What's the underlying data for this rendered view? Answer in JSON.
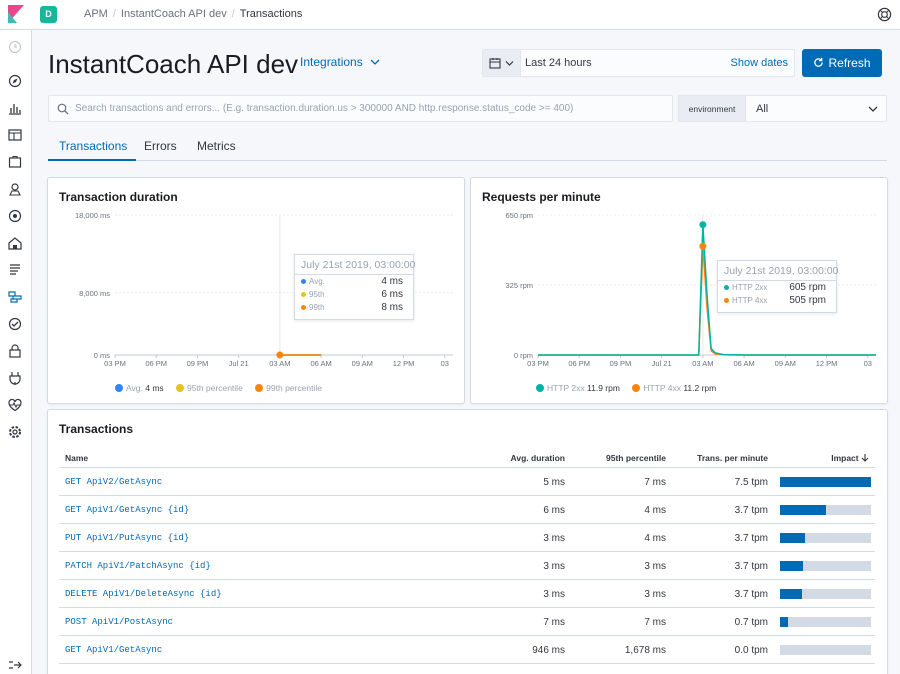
{
  "topbar": {
    "space_letter": "D",
    "breadcrumbs": [
      "APM",
      "InstantCoach API dev",
      "Transactions"
    ]
  },
  "header": {
    "title": "InstantCoach API dev",
    "integrations_label": "Integrations"
  },
  "datepicker": {
    "range": "Last 24 hours",
    "show_dates": "Show dates",
    "refresh_label": "Refresh"
  },
  "search": {
    "placeholder": "Search transactions and errors... (E.g. transaction.duration.us > 300000 AND http.response.status_code >= 400)"
  },
  "environment": {
    "label": "environment",
    "value": "All"
  },
  "tabs": [
    "Transactions",
    "Errors",
    "Metrics"
  ],
  "colors": {
    "accent": "#006bb4",
    "avg": "#3185fc",
    "p95": "#e6c220",
    "p99": "#f98510",
    "http2xx": "#00b3a4",
    "http4xx": "#f98510"
  },
  "duration_panel": {
    "title": "Transaction duration",
    "tooltip": {
      "title": "July 21st 2019, 03:00:00",
      "rows": [
        {
          "label": "Avg.",
          "value": "4 ms"
        },
        {
          "label": "95th",
          "value": "6 ms"
        },
        {
          "label": "99th",
          "value": "8 ms"
        }
      ]
    },
    "legend": [
      {
        "label": "Avg.",
        "value": "4 ms"
      },
      {
        "label": "95th percentile",
        "value": ""
      },
      {
        "label": "99th percentile",
        "value": ""
      }
    ]
  },
  "rpm_panel": {
    "title": "Requests per minute",
    "tooltip": {
      "title": "July 21st 2019, 03:00:00",
      "rows": [
        {
          "label": "HTTP 2xx",
          "value": "605 rpm"
        },
        {
          "label": "HTTP 4xx",
          "value": "505 rpm"
        }
      ]
    },
    "legend": [
      {
        "label": "HTTP 2xx",
        "value": "11.9 rpm"
      },
      {
        "label": "HTTP 4xx",
        "value": "11.2 rpm"
      }
    ]
  },
  "chart_data": [
    {
      "type": "line",
      "title": "Transaction duration",
      "y_ticks": [
        "18,000 ms",
        "8,000 ms",
        "0 ms"
      ],
      "x_ticks": [
        "03 PM",
        "06 PM",
        "09 PM",
        "Jul 21",
        "03 AM",
        "06 AM",
        "09 AM",
        "12 PM",
        "03"
      ],
      "ylim": [
        0,
        18000
      ],
      "x": [
        0,
        1,
        2,
        3,
        4,
        5,
        6,
        7,
        8
      ],
      "series": [
        {
          "name": "Avg.",
          "values": [
            null,
            null,
            null,
            null,
            4,
            4,
            null,
            null,
            null
          ]
        },
        {
          "name": "95th percentile",
          "values": [
            null,
            null,
            null,
            null,
            6,
            6,
            null,
            null,
            null
          ]
        },
        {
          "name": "99th percentile",
          "values": [
            null,
            null,
            null,
            null,
            8,
            8,
            null,
            null,
            null
          ]
        }
      ]
    },
    {
      "type": "line",
      "title": "Requests per minute",
      "y_ticks": [
        "650 rpm",
        "325 rpm",
        "0 rpm"
      ],
      "x_ticks": [
        "03 PM",
        "06 PM",
        "09 PM",
        "Jul 21",
        "03 AM",
        "06 AM",
        "09 AM",
        "12 PM",
        "03"
      ],
      "ylim": [
        0,
        650
      ],
      "x": [
        0,
        3,
        3.9,
        4.0,
        4.1,
        4.2,
        4.3,
        4.5,
        4.8,
        5.0,
        6.0,
        9.2
      ],
      "series": [
        {
          "name": "HTTP 2xx",
          "values": [
            0,
            0,
            0,
            605,
            280,
            30,
            10,
            2,
            1,
            0,
            0,
            0
          ]
        },
        {
          "name": "HTTP 4xx",
          "values": [
            0,
            0,
            0,
            505,
            220,
            20,
            5,
            1,
            0,
            0,
            0,
            0
          ]
        }
      ]
    }
  ],
  "transactions": {
    "title": "Transactions",
    "headers": {
      "name": "Name",
      "avg": "Avg. duration",
      "p95": "95th percentile",
      "tpm": "Trans. per minute",
      "impact": "Impact"
    },
    "rows": [
      {
        "name": "GET ApiV2/GetAsync",
        "avg": "5 ms",
        "p95": "7 ms",
        "tpm": "7.5 tpm",
        "impact": 100
      },
      {
        "name": "GET ApiV1/GetAsync {id}",
        "avg": "6 ms",
        "p95": "4 ms",
        "tpm": "3.7 tpm",
        "impact": 50
      },
      {
        "name": "PUT ApiV1/PutAsync {id}",
        "avg": "3 ms",
        "p95": "4 ms",
        "tpm": "3.7 tpm",
        "impact": 27
      },
      {
        "name": "PATCH ApiV1/PatchAsync {id}",
        "avg": "3 ms",
        "p95": "3 ms",
        "tpm": "3.7 tpm",
        "impact": 25
      },
      {
        "name": "DELETE ApiV1/DeleteAsync {id}",
        "avg": "3 ms",
        "p95": "3 ms",
        "tpm": "3.7 tpm",
        "impact": 24
      },
      {
        "name": "POST ApiV1/PostAsync",
        "avg": "7 ms",
        "p95": "7 ms",
        "tpm": "0.7 tpm",
        "impact": 9
      },
      {
        "name": "GET ApiV1/GetAsync",
        "avg": "946 ms",
        "p95": "1,678 ms",
        "tpm": "0.0 tpm",
        "impact": 0
      }
    ]
  }
}
